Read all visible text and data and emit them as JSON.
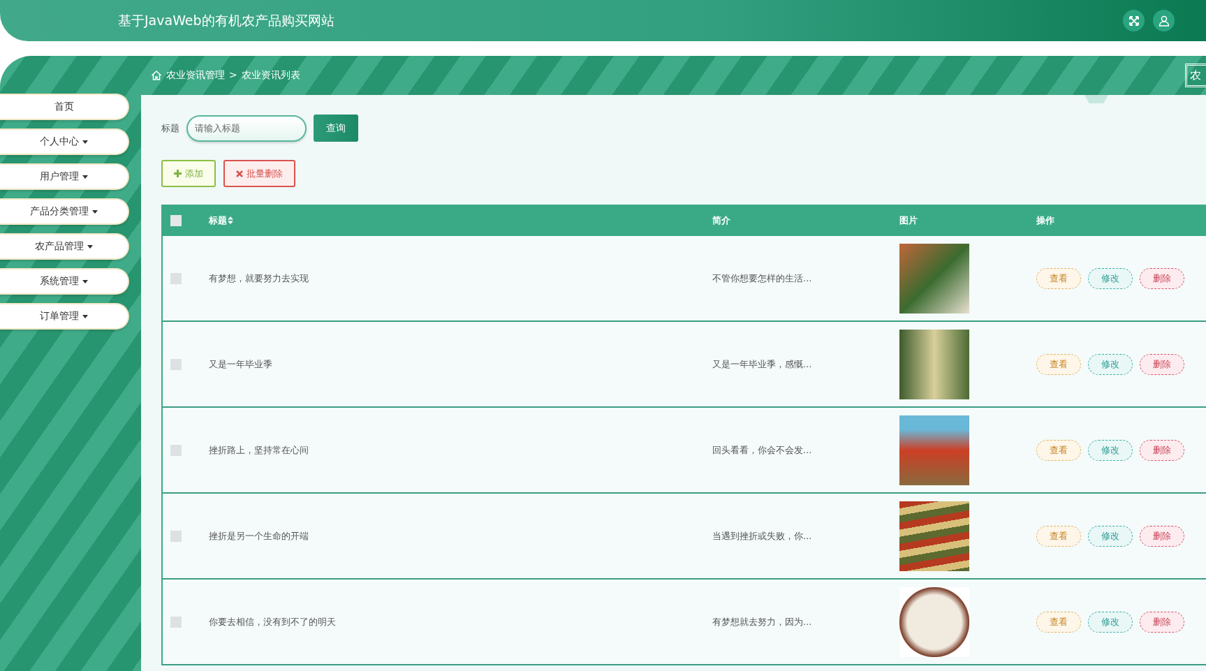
{
  "header": {
    "title": "基于JavaWeb的有机农产品购买网站"
  },
  "sidebar": {
    "items": [
      {
        "label": "首页",
        "kind": "link"
      },
      {
        "label": "个人中心",
        "kind": "dropdown"
      },
      {
        "label": "用户管理",
        "kind": "dropdown"
      },
      {
        "label": "产品分类管理",
        "kind": "dropdown"
      },
      {
        "label": "农产品管理",
        "kind": "dropdown"
      },
      {
        "label": "系统管理",
        "kind": "dropdown"
      },
      {
        "label": "订单管理",
        "kind": "dropdown"
      }
    ]
  },
  "breadcrumb": {
    "items": [
      "农业资讯管理",
      "农业资讯列表"
    ],
    "separator": ">",
    "side_button": "农"
  },
  "search": {
    "label": "标题",
    "placeholder": "请输入标题",
    "button": "查询"
  },
  "actions": {
    "add": "添加",
    "batch_delete": "批量删除"
  },
  "table": {
    "select_all_checked": false,
    "columns": [
      "标题",
      "简介",
      "图片",
      "操作"
    ],
    "rows": [
      {
        "checked": false,
        "title": "有梦想，就要努力去实现",
        "intro": "不管你想要怎样的生活...",
        "buttons": [
          "查看",
          "修改",
          "删除"
        ]
      },
      {
        "checked": false,
        "title": "又是一年毕业季",
        "intro": "又是一年毕业季，感慨...",
        "buttons": [
          "查看",
          "修改",
          "删除"
        ]
      },
      {
        "checked": false,
        "title": "挫折路上，坚持常在心间",
        "intro": "回头看看，你会不会发...",
        "buttons": [
          "查看",
          "修改",
          "删除"
        ]
      },
      {
        "checked": false,
        "title": "挫折是另一个生命的开端",
        "intro": "当遇到挫折或失败，你...",
        "buttons": [
          "查看",
          "修改",
          "删除"
        ]
      },
      {
        "checked": false,
        "title": "你要去相信，没有到不了的明天",
        "intro": "有梦想就去努力，因为...",
        "buttons": [
          "查看",
          "修改",
          "删除"
        ]
      }
    ]
  }
}
